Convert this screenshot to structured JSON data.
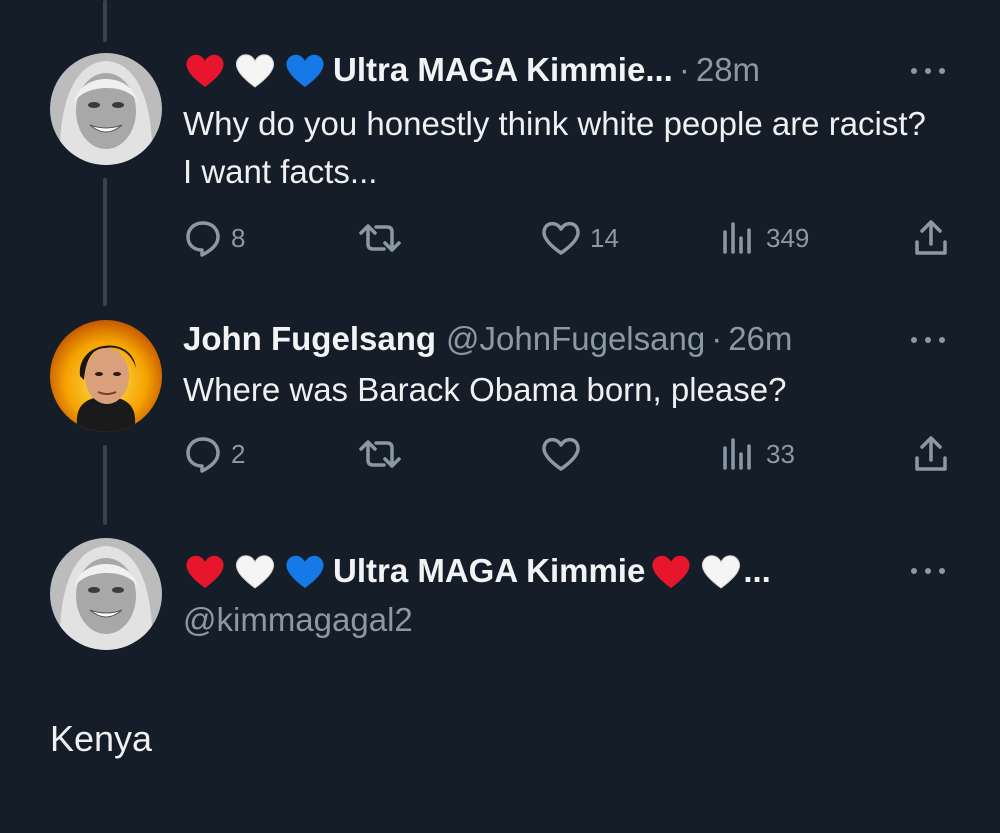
{
  "thread": [
    {
      "emoji_icons": [
        "red-heart-icon",
        "white-heart-icon",
        "blue-heart-icon"
      ],
      "display_name": "Ultra MAGA Kimmie...",
      "separator": "·",
      "time": "28m",
      "text": "Why do you honestly think white people are racist? I want facts...",
      "stats": {
        "replies": "8",
        "reposts": "",
        "likes": "14",
        "views": "349"
      }
    },
    {
      "display_name": "John Fugelsang",
      "handle": "@JohnFugelsang",
      "separator": "·",
      "time": "26m",
      "text": "Where was Barack Obama born, please?",
      "stats": {
        "replies": "2",
        "reposts": "",
        "likes": "",
        "views": "33"
      }
    }
  ],
  "reply": {
    "emoji_icons": [
      "red-heart-icon",
      "white-heart-icon",
      "blue-heart-icon",
      "red-heart-icon",
      "white-heart-icon"
    ],
    "display_name": "Ultra MAGA Kimmie",
    "ellipsis": "...",
    "handle": "@kimmagagal2",
    "text": "Kenya"
  },
  "colors": {
    "background": "#151d28",
    "primary_text": "#e7e9ea",
    "secondary_text": "#8b98a5",
    "thread_line": "#38444d"
  }
}
